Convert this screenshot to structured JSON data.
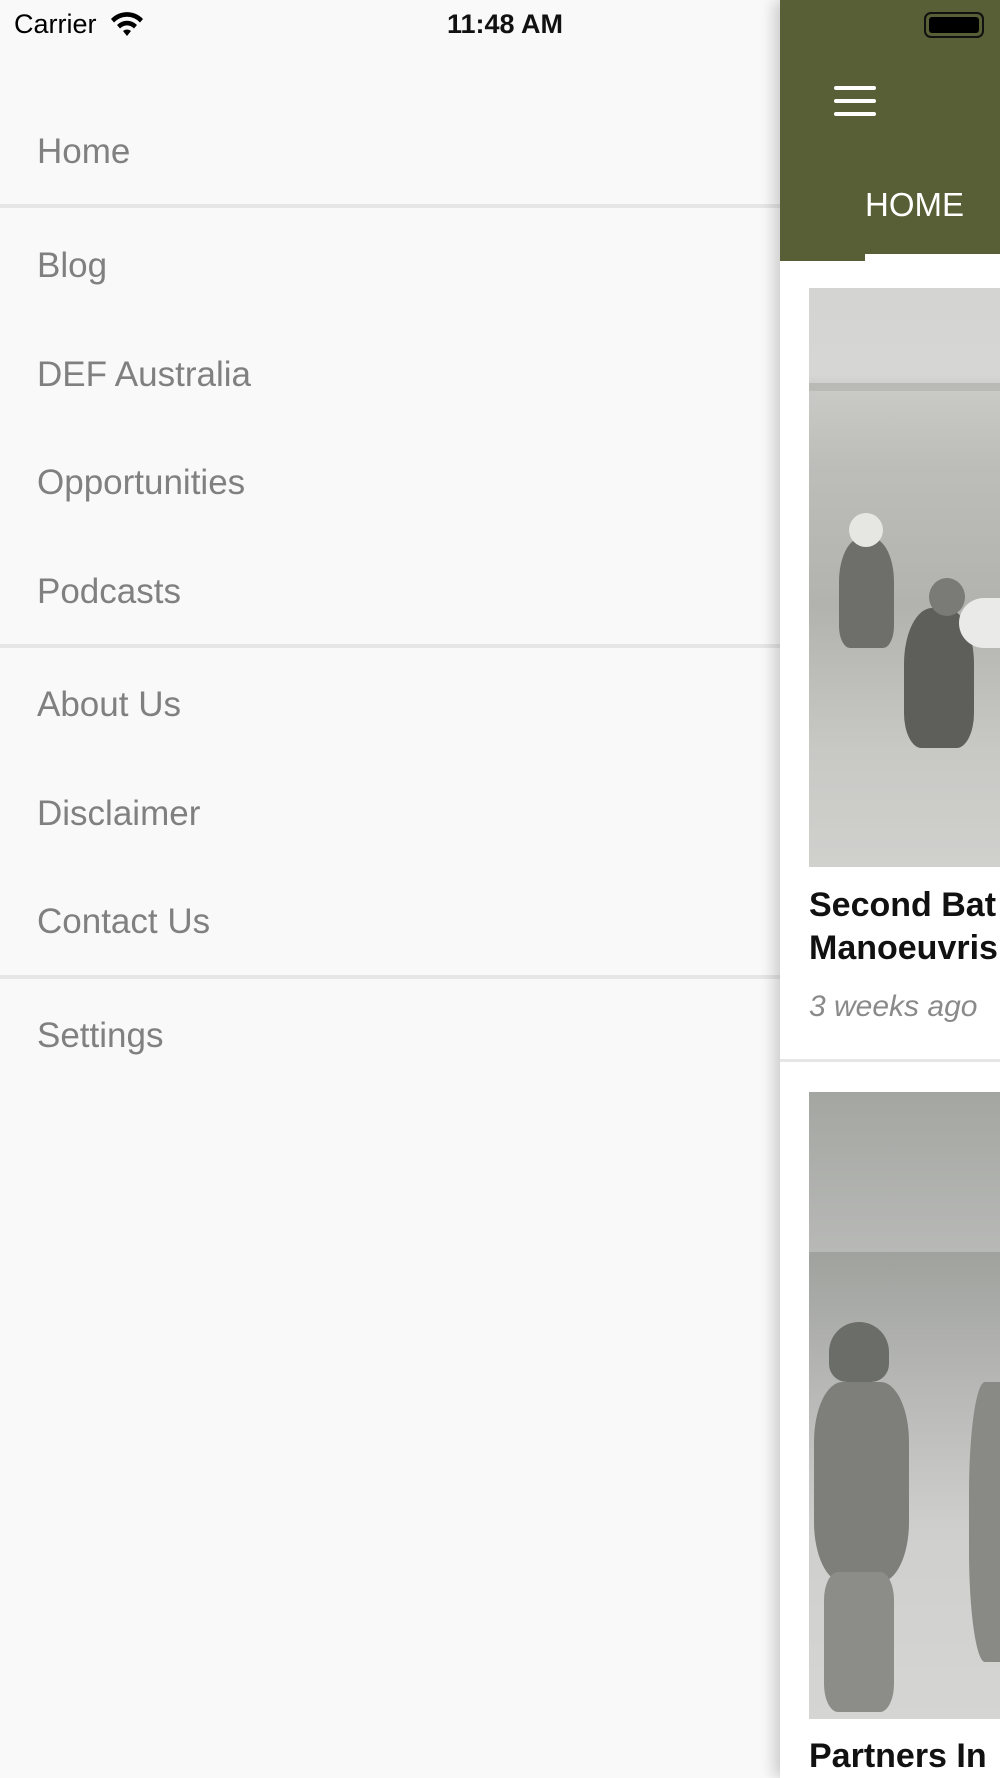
{
  "status_bar": {
    "carrier": "Carrier",
    "time": "11:48 AM"
  },
  "drawer": {
    "items": [
      {
        "label": "Home"
      },
      {
        "label": "Blog"
      },
      {
        "label": "DEF Australia"
      },
      {
        "label": "Opportunities"
      },
      {
        "label": "Podcasts"
      },
      {
        "label": "About Us"
      },
      {
        "label": "Disclaimer"
      },
      {
        "label": "Contact Us"
      },
      {
        "label": "Settings"
      }
    ]
  },
  "main": {
    "app_bar_color": "#585e35",
    "tabs": [
      {
        "label": "HOME",
        "selected": true
      }
    ],
    "articles": [
      {
        "title_line1": "Second Bat",
        "title_line2": "Manoeuvris",
        "time": "3 weeks ago"
      },
      {
        "title_line1": "Partners In"
      }
    ]
  }
}
